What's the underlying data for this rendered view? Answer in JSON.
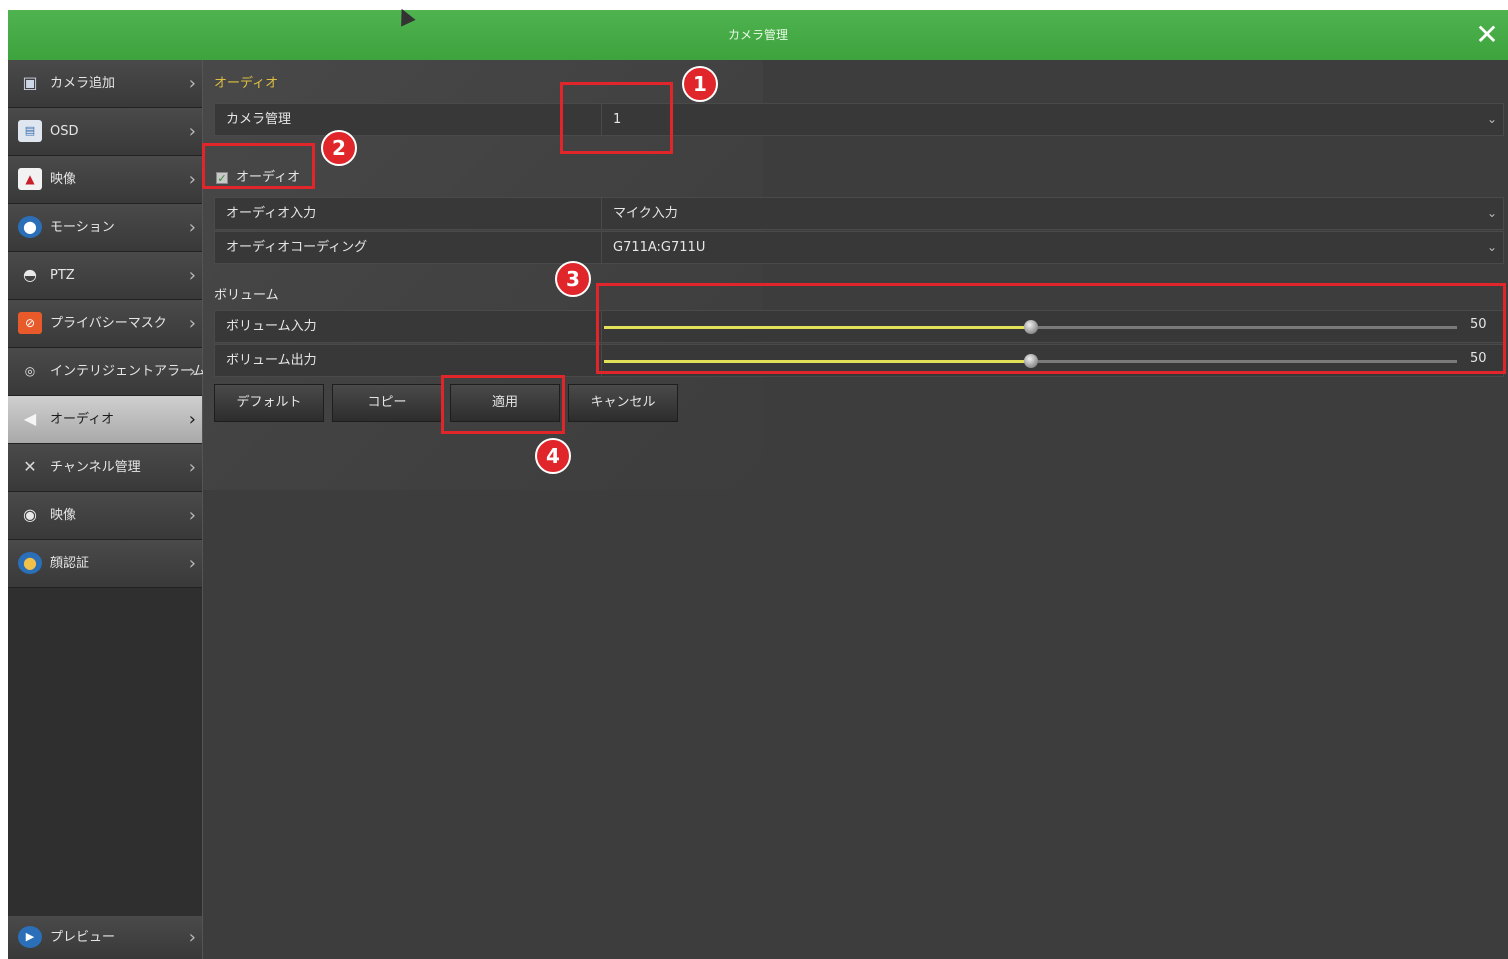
{
  "window": {
    "title": "カメラ管理",
    "close_icon": "close-icon"
  },
  "sidebar": {
    "items": [
      {
        "label": "カメラ追加",
        "icon": "camera-add-icon"
      },
      {
        "label": "OSD",
        "icon": "osd-icon"
      },
      {
        "label": "映像",
        "icon": "image-icon"
      },
      {
        "label": "モーション",
        "icon": "motion-icon"
      },
      {
        "label": "PTZ",
        "icon": "ptz-icon"
      },
      {
        "label": "プライバシーマスク",
        "icon": "privacy-mask-icon"
      },
      {
        "label": "インテリジェントアラーム",
        "icon": "intelligent-alarm-icon"
      },
      {
        "label": "オーディオ",
        "icon": "speaker-icon",
        "active": true
      },
      {
        "label": "チャンネル管理",
        "icon": "tools-icon"
      },
      {
        "label": "映像",
        "icon": "webcam-icon"
      },
      {
        "label": "顔認証",
        "icon": "face-recognition-icon"
      }
    ],
    "footer_item": {
      "label": "プレビュー",
      "icon": "preview-icon"
    }
  },
  "main": {
    "section_title": "オーディオ",
    "camera": {
      "label": "カメラ管理",
      "value": "1"
    },
    "audio_checkbox": {
      "label": "オーディオ",
      "checked": true
    },
    "audio_input": {
      "label": "オーディオ入力",
      "value": "マイク入力"
    },
    "audio_encoding": {
      "label": "オーディオコーディング",
      "value": "G711A:G711U"
    },
    "volume_title": "ボリューム",
    "volume_input": {
      "label": "ボリューム入力",
      "value": "50",
      "fraction": 0.5
    },
    "volume_output": {
      "label": "ボリューム出力",
      "value": "50",
      "fraction": 0.5
    },
    "buttons": {
      "default": "デフォルト",
      "copy": "コピー",
      "apply": "適用",
      "cancel": "キャンセル"
    }
  },
  "annotations": {
    "badge1": "1",
    "badge2": "2",
    "badge3": "3",
    "badge4": "4",
    "color": "#e0262a"
  }
}
